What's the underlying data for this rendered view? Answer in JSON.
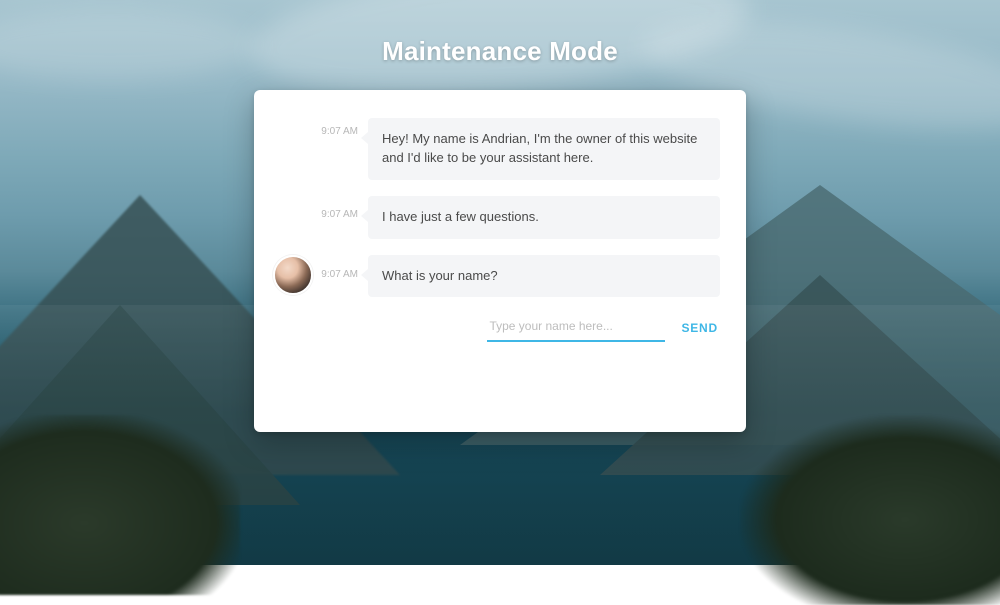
{
  "title": "Maintenance Mode",
  "colors": {
    "accent": "#3fb7e6",
    "bubble_bg": "#f4f5f7",
    "timestamp": "#b7b7b7"
  },
  "chat": {
    "messages": [
      {
        "time": "9:07 AM",
        "text": "Hey! My name is Andrian, I'm the owner of this website and I'd like to be your assistant here.",
        "show_avatar": false
      },
      {
        "time": "9:07 AM",
        "text": "I have just a few questions.",
        "show_avatar": false
      },
      {
        "time": "9:07 AM",
        "text": "What is your name?",
        "show_avatar": true
      }
    ],
    "input": {
      "placeholder": "Type your name here...",
      "value": ""
    },
    "send_label": "SEND"
  }
}
